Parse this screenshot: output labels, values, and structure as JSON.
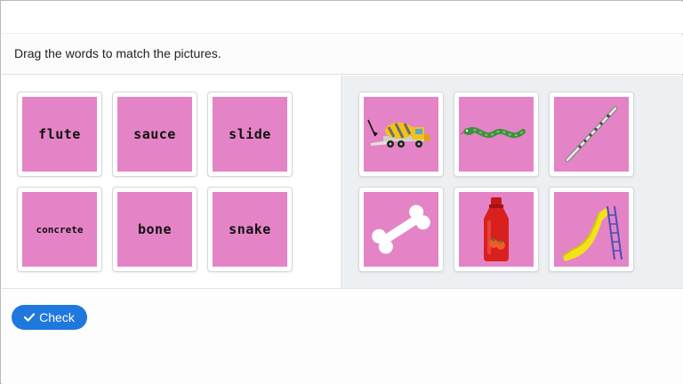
{
  "instruction": "Drag the words to match the pictures.",
  "words": [
    {
      "label": "flute"
    },
    {
      "label": "sauce"
    },
    {
      "label": "slide"
    },
    {
      "label": "concrete"
    },
    {
      "label": "bone"
    },
    {
      "label": "snake"
    }
  ],
  "pictures": [
    {
      "icon": "concrete-mixer-truck-icon"
    },
    {
      "icon": "snake-icon"
    },
    {
      "icon": "flute-icon"
    },
    {
      "icon": "bone-icon"
    },
    {
      "icon": "ketchup-bottle-icon"
    },
    {
      "icon": "playground-slide-icon"
    }
  ],
  "check_button": {
    "label": "Check",
    "icon": "checkmark-icon"
  },
  "colors": {
    "card_fill": "#e484c6",
    "button": "#1f78de",
    "target_panel": "#ecf0f3"
  }
}
